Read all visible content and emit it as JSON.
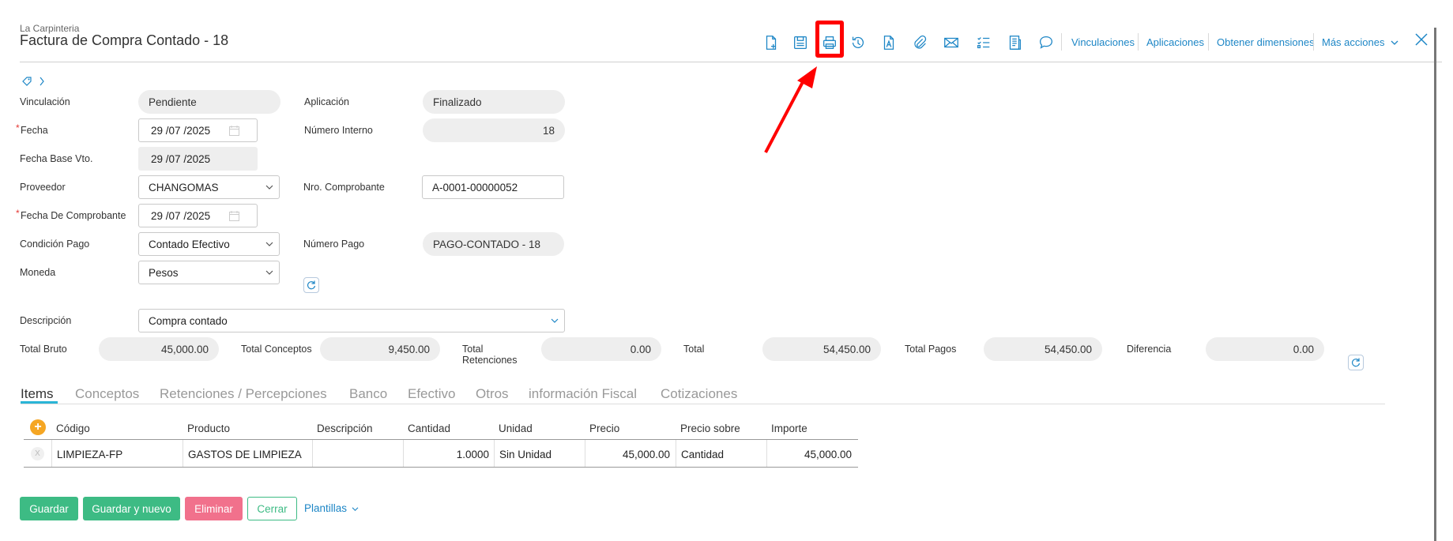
{
  "header": {
    "company": "La Carpinteria",
    "title": "Factura de Compra Contado - 18",
    "toolbar_icons": [
      "new-document-icon",
      "save-icon",
      "print-icon",
      "history-icon",
      "text-document-icon",
      "attachment-icon",
      "mail-icon",
      "checklist-icon",
      "report-icon",
      "comment-icon"
    ],
    "links": {
      "vinculaciones": "Vinculaciones",
      "aplicaciones": "Aplicaciones",
      "obtener_dimensiones": "Obtener dimensiones",
      "mas_acciones": "Más acciones"
    },
    "accent_color": "#1d86c6",
    "highlight_color": "#ff0000"
  },
  "form": {
    "vinculacion": {
      "label": "Vinculación",
      "value": "Pendiente"
    },
    "aplicacion": {
      "label": "Aplicación",
      "value": "Finalizado"
    },
    "fecha": {
      "label": "Fecha",
      "day": "29",
      "month": "07",
      "year": "2025"
    },
    "numero_interno": {
      "label": "Número Interno",
      "value": "18"
    },
    "fecha_base_vto": {
      "label": "Fecha Base Vto.",
      "day": "29",
      "month": "07",
      "year": "2025"
    },
    "proveedor": {
      "label": "Proveedor",
      "value": "CHANGOMAS"
    },
    "nro_comprobante": {
      "label": "Nro. Comprobante",
      "value": "A-0001-00000052"
    },
    "fecha_comprobante": {
      "label": "Fecha De Comprobante",
      "day": "29",
      "month": "07",
      "year": "2025"
    },
    "condicion_pago": {
      "label": "Condición Pago",
      "value": "Contado Efectivo"
    },
    "numero_pago": {
      "label": "Número Pago",
      "value": "PAGO-CONTADO - 18"
    },
    "moneda": {
      "label": "Moneda",
      "value": "Pesos"
    },
    "descripcion": {
      "label": "Descripción",
      "value": "Compra contado"
    }
  },
  "totals": {
    "total_bruto": {
      "label": "Total Bruto",
      "value": "45,000.00"
    },
    "total_conceptos": {
      "label": "Total Conceptos",
      "value": "9,450.00"
    },
    "total_retenciones": {
      "label_line1": "Total",
      "label_line2": "Retenciones",
      "value": "0.00"
    },
    "total": {
      "label": "Total",
      "value": "54,450.00"
    },
    "total_pagos": {
      "label": "Total Pagos",
      "value": "54,450.00"
    },
    "diferencia": {
      "label": "Diferencia",
      "value": "0.00"
    }
  },
  "tabs": [
    "Items",
    "Conceptos",
    "Retenciones / Percepciones",
    "Banco",
    "Efectivo",
    "Otros",
    "información Fiscal",
    "Cotizaciones"
  ],
  "table": {
    "columns": [
      "Código",
      "Producto",
      "Descripción",
      "Cantidad",
      "Unidad",
      "Precio",
      "Precio sobre",
      "Importe"
    ],
    "rows": [
      [
        "LIMPIEZA-FP",
        "GASTOS DE LIMPIEZA",
        "",
        "1.0000",
        "Sin Unidad",
        "45,000.00",
        "Cantidad",
        "45,000.00"
      ]
    ]
  },
  "actions": {
    "guardar": "Guardar",
    "guardar_y_nuevo": "Guardar y nuevo",
    "eliminar": "Eliminar",
    "cerrar": "Cerrar",
    "plantillas": "Plantillas"
  }
}
